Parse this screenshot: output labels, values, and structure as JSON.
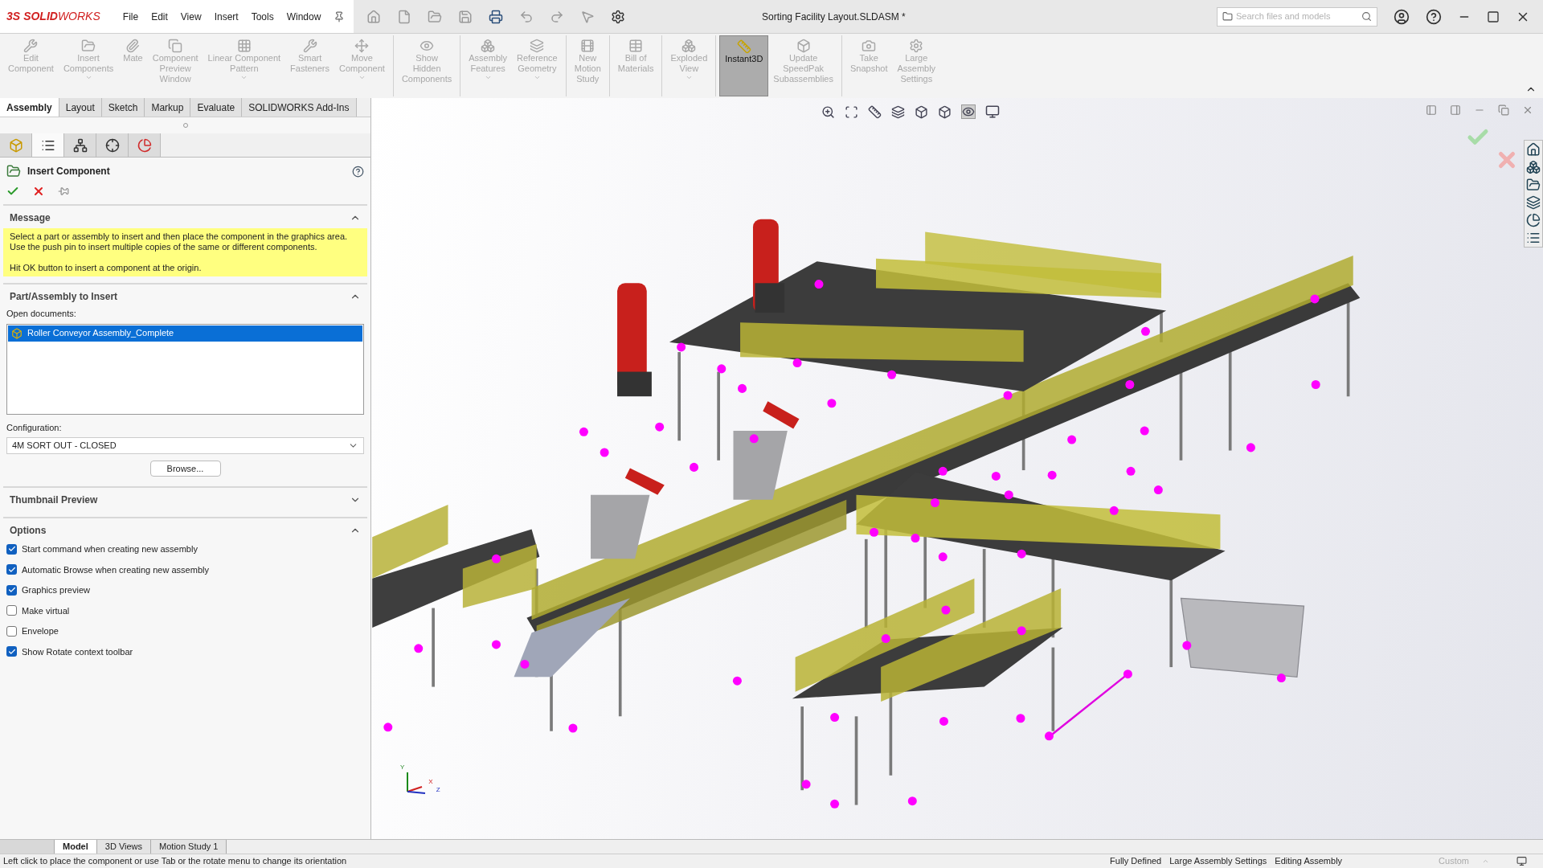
{
  "app": {
    "logo_prefix": "3S",
    "logo_bold": "SOLID",
    "logo_rest": "WORKS"
  },
  "menu": [
    "File",
    "Edit",
    "View",
    "Insert",
    "Tools",
    "Window"
  ],
  "window": {
    "title": "Sorting Facility Layout.SLDASM *"
  },
  "search": {
    "placeholder": "Search files and models"
  },
  "commands": [
    {
      "label": "Edit\nComponent",
      "disabled": true,
      "selected": false,
      "dropdown": false,
      "divider": false
    },
    {
      "label": "Insert\nComponents",
      "disabled": true,
      "selected": false,
      "dropdown": true,
      "divider": false
    },
    {
      "label": "Mate",
      "disabled": true,
      "selected": false,
      "dropdown": false,
      "divider": false
    },
    {
      "label": "Component\nPreview\nWindow",
      "disabled": true,
      "selected": false,
      "dropdown": false,
      "divider": false
    },
    {
      "label": "Linear Component\nPattern",
      "disabled": true,
      "selected": false,
      "dropdown": true,
      "divider": false
    },
    {
      "label": "Smart\nFasteners",
      "disabled": true,
      "selected": false,
      "dropdown": false,
      "divider": false
    },
    {
      "label": "Move\nComponent",
      "disabled": true,
      "selected": false,
      "dropdown": true,
      "divider": true
    },
    {
      "label": "Show\nHidden\nComponents",
      "disabled": true,
      "selected": false,
      "dropdown": false,
      "divider": true
    },
    {
      "label": "Assembly\nFeatures",
      "disabled": true,
      "selected": false,
      "dropdown": true,
      "divider": false
    },
    {
      "label": "Reference\nGeometry",
      "disabled": true,
      "selected": false,
      "dropdown": true,
      "divider": true
    },
    {
      "label": "New\nMotion\nStudy",
      "disabled": true,
      "selected": false,
      "dropdown": false,
      "divider": true
    },
    {
      "label": "Bill of\nMaterials",
      "disabled": true,
      "selected": false,
      "dropdown": false,
      "divider": true
    },
    {
      "label": "Exploded\nView",
      "disabled": true,
      "selected": false,
      "dropdown": true,
      "divider": true
    },
    {
      "label": "Instant3D",
      "disabled": false,
      "selected": true,
      "dropdown": false,
      "divider": false
    },
    {
      "label": "Update\nSpeedPak\nSubassemblies",
      "disabled": true,
      "selected": false,
      "dropdown": false,
      "divider": true
    },
    {
      "label": "Take\nSnapshot",
      "disabled": true,
      "selected": false,
      "dropdown": false,
      "divider": false
    },
    {
      "label": "Large\nAssembly\nSettings",
      "disabled": true,
      "selected": false,
      "dropdown": false,
      "divider": false
    }
  ],
  "tabs": [
    {
      "label": "Assembly",
      "selected": true
    },
    {
      "label": "Layout",
      "selected": false
    },
    {
      "label": "Sketch",
      "selected": false
    },
    {
      "label": "Markup",
      "selected": false
    },
    {
      "label": "Evaluate",
      "selected": false
    },
    {
      "label": "SOLIDWORKS Add-Ins",
      "selected": false
    }
  ],
  "manager_tabs": [
    {
      "selected": false
    },
    {
      "selected": true
    },
    {
      "selected": false
    },
    {
      "selected": false
    },
    {
      "selected": false
    }
  ],
  "property_manager": {
    "title": "Insert Component",
    "message": {
      "title": "Message",
      "expanded": true,
      "lines": [
        "Select a part or assembly to insert and then place the component in the graphics area.",
        "Use the push pin to insert multiple copies of the same or different components.",
        "Hit OK button to insert a component at the origin."
      ]
    },
    "insert": {
      "title": "Part/Assembly to Insert",
      "expanded": true,
      "list_label": "Open documents:",
      "documents": [
        {
          "name": "Roller Conveyor Assembly_Complete",
          "selected": true
        }
      ],
      "config_label": "Configuration:",
      "config_value": "4M SORT OUT - CLOSED",
      "browse": "Browse..."
    },
    "thumbnail": {
      "title": "Thumbnail Preview",
      "expanded": false
    },
    "options": {
      "title": "Options",
      "expanded": true,
      "items": [
        {
          "label": "Start command when creating new assembly",
          "checked": true
        },
        {
          "label": "Automatic Browse when creating new assembly",
          "checked": true
        },
        {
          "label": "Graphics preview",
          "checked": true
        },
        {
          "label": "Make virtual",
          "checked": false
        },
        {
          "label": "Envelope",
          "checked": false
        },
        {
          "label": "Show Rotate context toolbar",
          "checked": true
        }
      ]
    }
  },
  "triad": [
    "Y",
    "X",
    "Z"
  ],
  "bottom_tabs": [
    {
      "label": "Model",
      "selected": true
    },
    {
      "label": "3D Views",
      "selected": false
    },
    {
      "label": "Motion Study 1",
      "selected": false
    }
  ],
  "status_bar": {
    "message": "Left click to place the component or use Tab or the rotate menu to change its orientation",
    "items": [
      "Fully Defined",
      "Large Assembly Settings",
      "Editing Assembly"
    ],
    "units": "Custom"
  }
}
